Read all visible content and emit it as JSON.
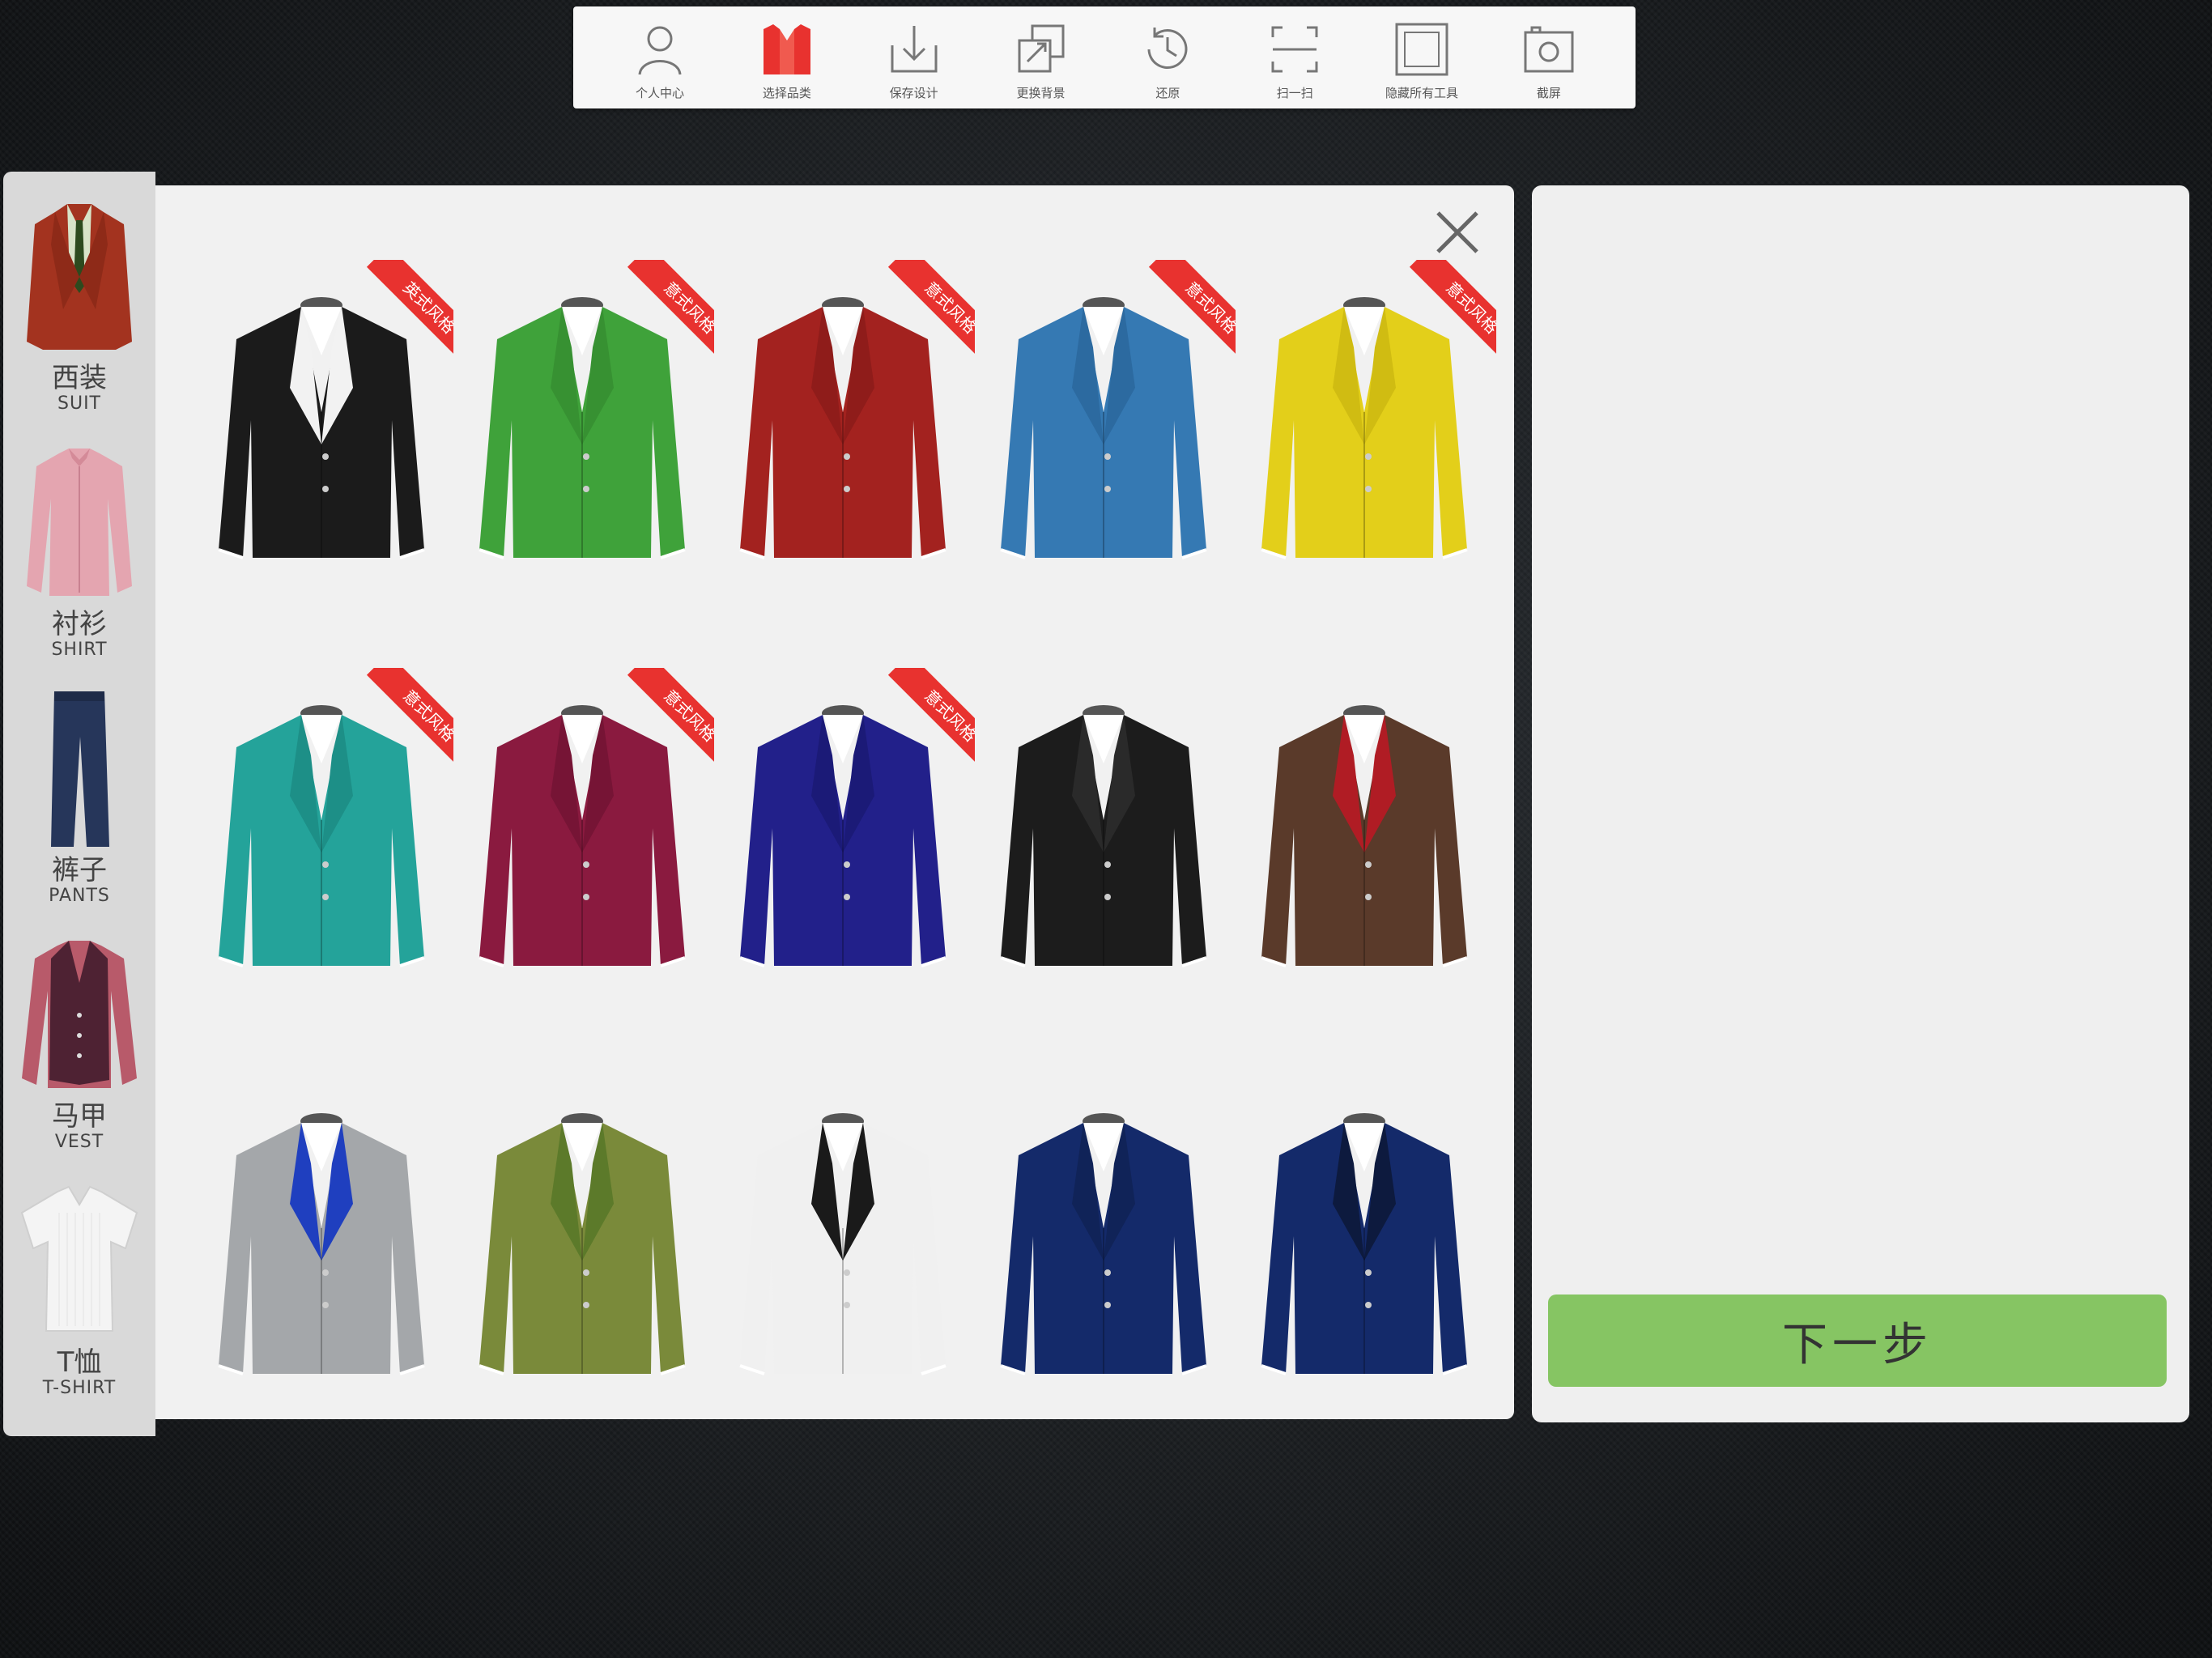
{
  "toolbar": {
    "items": [
      {
        "label": "个人中心",
        "icon": "user-icon"
      },
      {
        "label": "选择品类",
        "icon": "category-icon"
      },
      {
        "label": "保存设计",
        "icon": "download-icon"
      },
      {
        "label": "更换背景",
        "icon": "swap-background-icon"
      },
      {
        "label": "还原",
        "icon": "history-icon"
      },
      {
        "label": "扫一扫",
        "icon": "scan-icon"
      },
      {
        "label": "隐藏所有工具",
        "icon": "hide-tools-icon"
      },
      {
        "label": "截屏",
        "icon": "camera-icon"
      }
    ],
    "accent": "#e8322f"
  },
  "sidebar": {
    "categories": [
      {
        "zh": "西装",
        "en": "SUIT"
      },
      {
        "zh": "衬衫",
        "en": "SHIRT"
      },
      {
        "zh": "裤子",
        "en": "PANTS"
      },
      {
        "zh": "马甲",
        "en": "VEST"
      },
      {
        "zh": "T恤",
        "en": "T-SHIRT"
      }
    ]
  },
  "products": [
    {
      "color": "#1b1b1b",
      "lapel": "#f2f2f2",
      "ribbon": "英式风格"
    },
    {
      "color": "#3fa23a",
      "lapel": "#379132",
      "ribbon": "意式风格"
    },
    {
      "color": "#a3221f",
      "lapel": "#8f1c1a",
      "ribbon": "意式风格"
    },
    {
      "color": "#3579b3",
      "lapel": "#2c6aa0",
      "ribbon": "意式风格"
    },
    {
      "color": "#e3cf1a",
      "lapel": "#d0bc12",
      "ribbon": "意式风格"
    },
    {
      "color": "#24a39a",
      "lapel": "#1d8f87",
      "ribbon": "意式风格"
    },
    {
      "color": "#8a1a3f",
      "lapel": "#761435",
      "ribbon": "意式风格"
    },
    {
      "color": "#22208a",
      "lapel": "#1b1a77",
      "ribbon": "意式风格"
    },
    {
      "color": "#1c1c1c",
      "lapel": "#2a2a2a",
      "ribbon": ""
    },
    {
      "color": "#5a3a2a",
      "lapel": "#b01c24",
      "ribbon": ""
    },
    {
      "color": "#a4a7aa",
      "lapel": "#1f3fbf",
      "ribbon": ""
    },
    {
      "color": "#7a8a3a",
      "lapel": "#5c7a2a",
      "ribbon": ""
    },
    {
      "color": "#f0f0f0",
      "lapel": "#1a1a1a",
      "ribbon": ""
    },
    {
      "color": "#142a6a",
      "lapel": "#102358",
      "ribbon": ""
    },
    {
      "color": "#142a6a",
      "lapel": "#0d1a3e",
      "ribbon": ""
    }
  ],
  "next_button": {
    "label": "下一步",
    "color": "#86c563"
  }
}
